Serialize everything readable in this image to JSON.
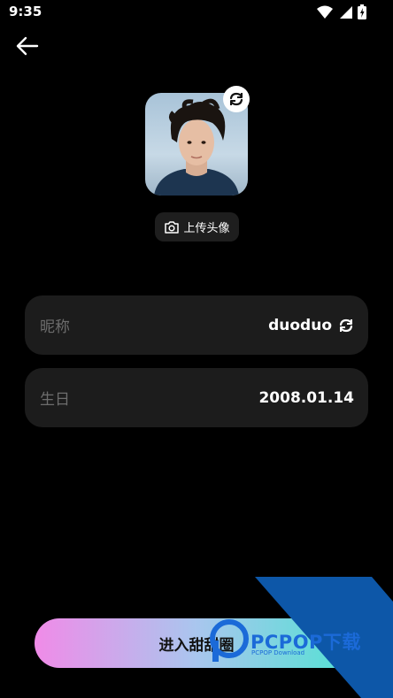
{
  "status_bar": {
    "time": "9:35",
    "icons": [
      "wifi-icon",
      "signal-icon",
      "battery-icon"
    ]
  },
  "header": {
    "back_icon": "arrow-left-icon"
  },
  "avatar": {
    "refresh_icon": "refresh-icon",
    "upload_label": "上传头像",
    "upload_icon": "camera-icon"
  },
  "fields": [
    {
      "label": "昵称",
      "value": "duoduo",
      "action_icon": "refresh-icon"
    },
    {
      "label": "生日",
      "value": "2008.01.14"
    }
  ],
  "enter_button": {
    "label": "进入甜甜圈"
  },
  "watermark": {
    "brand": "PCPOP下载",
    "sub": "PCPOP Download"
  },
  "colors": {
    "background": "#000000",
    "card": "#1c1c1c",
    "gradient_start": "#f08be8",
    "gradient_end": "#4fe3d2",
    "watermark": "#1b6ad8"
  }
}
